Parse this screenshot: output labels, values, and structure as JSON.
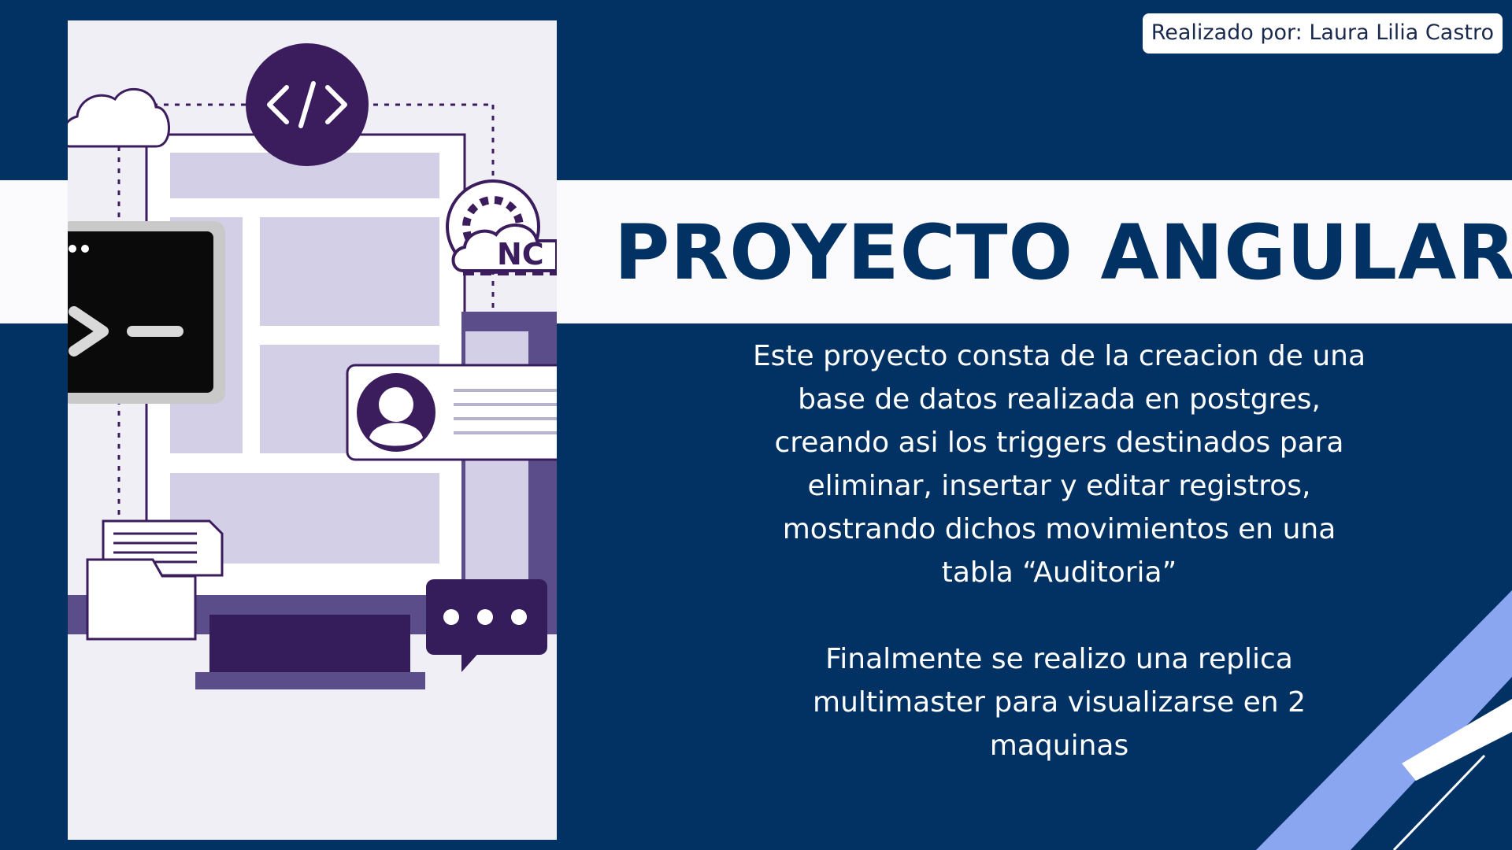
{
  "slide": {
    "author": "Realizado por: Laura Lilia Castro",
    "title": "PROYECTO ANGULAR",
    "paragraphs": [
      "Este proyecto consta de la creacion de una base de datos realizada en postgres, creando asi los triggers destinados para eliminar, insertar y editar registros, mostrando dichos movimientos en una tabla “Auditoria”",
      "Finalmente se realizo una replica multimaster para visualizarse en 2 maquinas"
    ]
  },
  "illustration": {
    "code_symbol": "</>",
    "cloud_badge": "NC",
    "icons": [
      "cloud-icon",
      "code-icon",
      "terminal-icon",
      "user-profile-icon",
      "document-folder-icon",
      "chat-bubble-icon",
      "cloud-settings-icon"
    ]
  },
  "colors": {
    "background": "#013263",
    "band": "#fbfbfd",
    "title": "#013263",
    "illustration_bg": "#f0eff6",
    "purple_dark": "#3b1d5e",
    "purple_light": "#d3cfe6",
    "accent_blue": "#8aa6f1"
  }
}
